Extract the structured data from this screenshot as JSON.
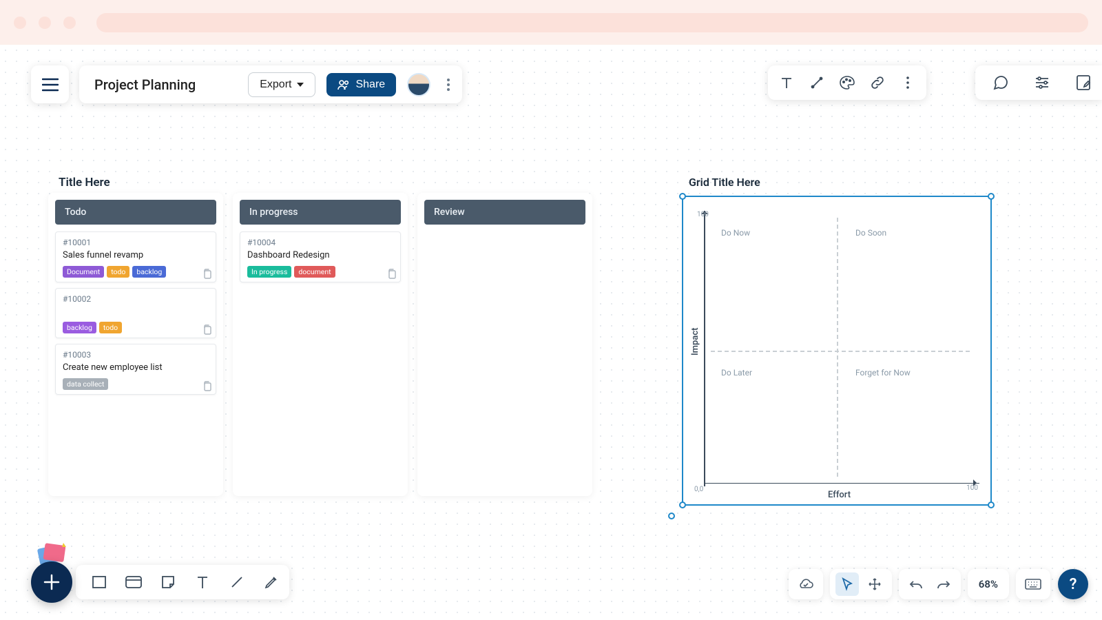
{
  "header": {
    "title": "Project Planning",
    "export_label": "Export",
    "share_label": "Share"
  },
  "kanban": {
    "title": "Title Here",
    "lanes": [
      {
        "name": "Todo",
        "cards": [
          {
            "id": "#10001",
            "title": "Sales funnel revamp",
            "tags": [
              {
                "text": "Document",
                "color": "#8e5ad6"
              },
              {
                "text": "todo",
                "color": "#f0a530"
              },
              {
                "text": "backlog",
                "color": "#4a6ad6"
              }
            ]
          },
          {
            "id": "#10002",
            "title": "",
            "tags": [
              {
                "text": "backlog",
                "color": "#9a5ce0"
              },
              {
                "text": "todo",
                "color": "#f0a530"
              }
            ]
          },
          {
            "id": "#10003",
            "title": "Create new employee list",
            "tags": [
              {
                "text": "data collect",
                "color": "#a8b0b8"
              }
            ]
          }
        ]
      },
      {
        "name": "In progress",
        "cards": [
          {
            "id": "#10004",
            "title": "Dashboard Redesign",
            "tags": [
              {
                "text": "In progress",
                "color": "#1abc9c"
              },
              {
                "text": "document",
                "color": "#e05a5a"
              }
            ]
          }
        ]
      },
      {
        "name": "Review",
        "cards": []
      }
    ]
  },
  "grid": {
    "title": "Grid Title Here",
    "y_label": "Impact",
    "x_label": "Effort",
    "quadrants": {
      "top_left": "Do Now",
      "top_right": "Do Soon",
      "bottom_left": "Do Later",
      "bottom_right": "Forget for Now"
    },
    "origin": "0,0",
    "y_max": "100",
    "x_max": "100"
  },
  "zoom": "68%",
  "colors": {
    "primary": "#0b4a82",
    "dark": "#0b2a52",
    "selection": "#1e88c9"
  }
}
